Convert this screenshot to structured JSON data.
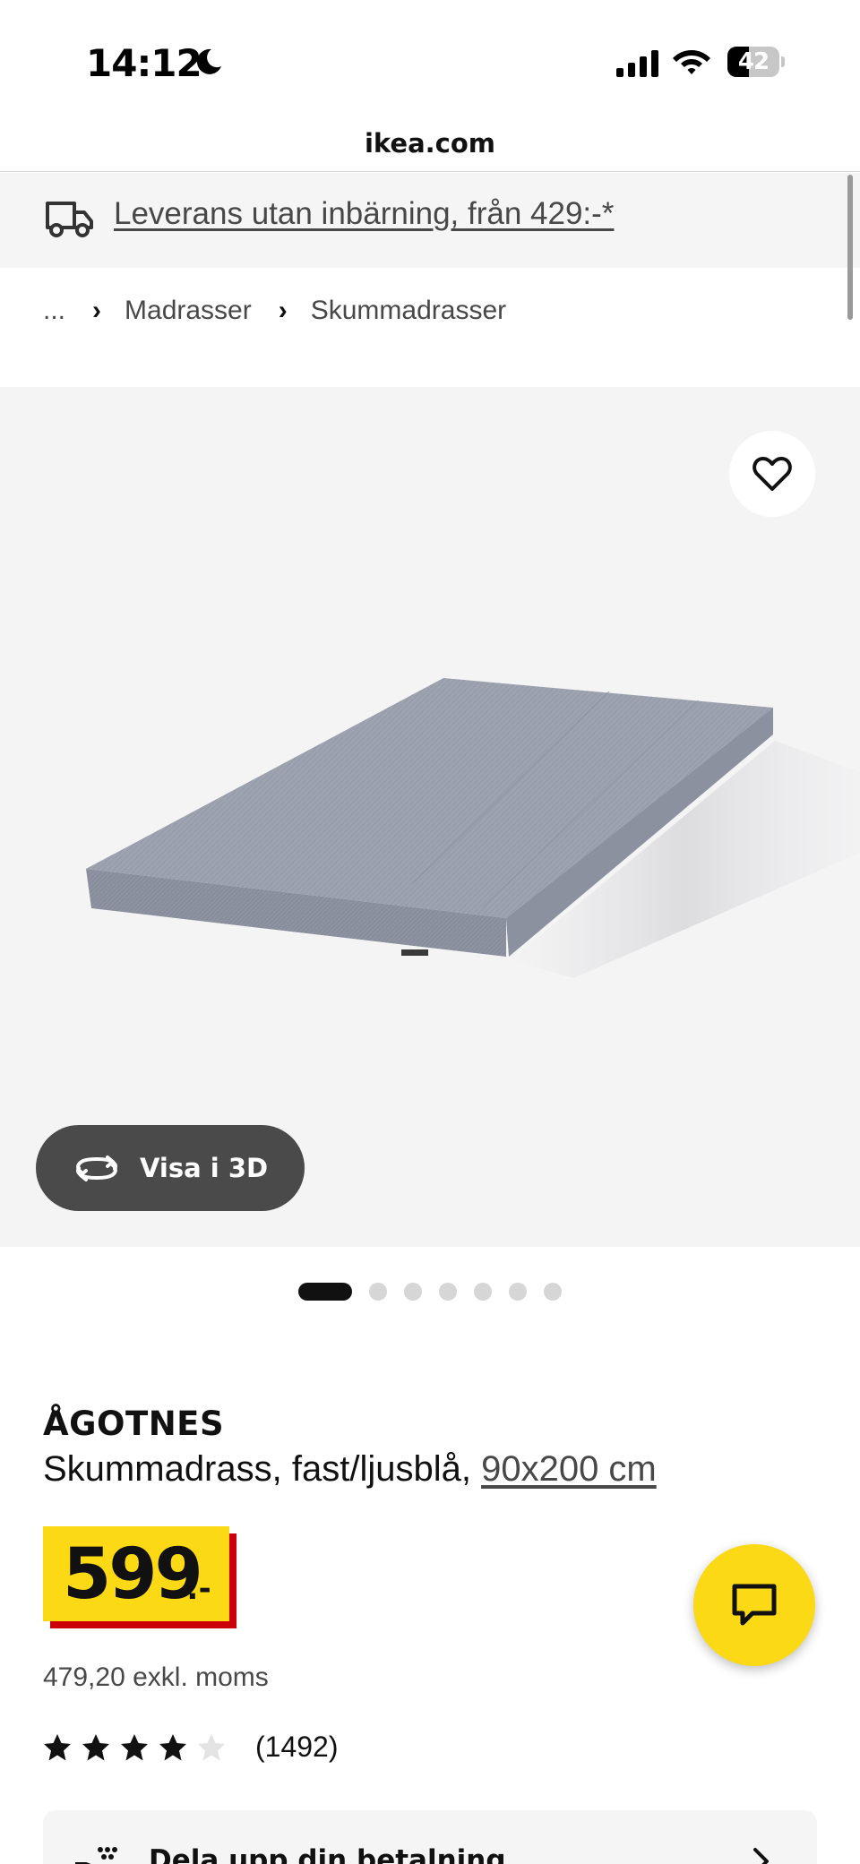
{
  "status_bar": {
    "time": "14:12",
    "battery_level": "42",
    "battery_fraction": 0.42
  },
  "browser": {
    "url": "ikea.com"
  },
  "delivery_banner": {
    "text": "Leverans utan inbärning, från 429:-*"
  },
  "breadcrumb": {
    "ellipsis": "...",
    "items": [
      "Madrasser",
      "Skummadrasser"
    ]
  },
  "gallery": {
    "view_3d_label": "Visa i 3D",
    "image_count": 7,
    "active_index": 0
  },
  "product": {
    "name": "ÅGOTNES",
    "description": "Skummadrass, fast/ljusblå,",
    "size": "90x200 cm",
    "price": "599",
    "price_suffix": ":-",
    "price_excl_vat": "479,20 exkl. moms",
    "rating": 4,
    "rating_max": 5,
    "review_count": "(1492)"
  },
  "payment": {
    "label": "Dela upp din betalning"
  },
  "colors": {
    "ikea_yellow": "#fbd914",
    "price_red": "#cc0008",
    "text_dark": "#111111",
    "text_grey": "#484848"
  },
  "icons": [
    "moon-icon",
    "signal-icon",
    "wifi-icon",
    "truck-icon",
    "heart-icon",
    "rotate-3d-icon",
    "chat-icon",
    "star-icon",
    "chevron-right-icon",
    "payment-icon"
  ]
}
